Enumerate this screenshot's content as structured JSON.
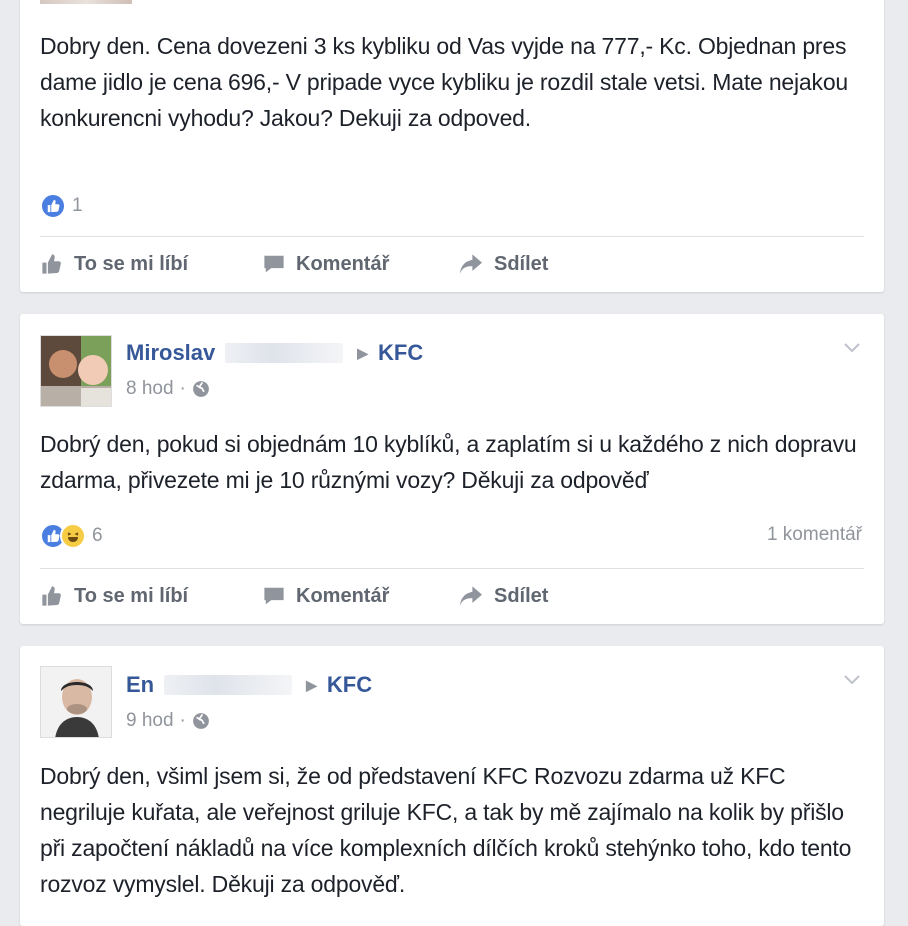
{
  "posts": [
    {
      "text": "Dobry den. Cena dovezeni 3 ks kybliku od Vas vyjde na 777,- Kc. Objednan pres dame jidlo je cena 696,- V pripade vyce kybliku je rozdil stale vetsi. Mate nejakou konkurencni vyhodu? Jakou? Dekuji za odpoved.",
      "reaction_count": "1"
    },
    {
      "author": "Miroslav",
      "page": "KFC",
      "time": "8 hod",
      "text": "Dobrý den, pokud si objednám 10 kyblíků, a zaplatím si u každého z nich dopravu zdarma, přivezete mi je 10 různými vozy? Děkuji za odpověď",
      "reaction_count": "6",
      "comments_count": "1 komentář"
    },
    {
      "author": "En",
      "page": "KFC",
      "time": "9 hod",
      "text": "Dobrý den, všiml jsem si, že od představení KFC Rozvozu zdarma už KFC negriluje kuřata, ale veřejnost griluje KFC, a tak by mě zajímalo na kolik by přišlo při započtení nákladů na více komplexních dílčích kroků stehýnko toho, kdo tento rozvoz vymyslel. Děkuji za odpověď."
    }
  ],
  "actions": {
    "like": "To se mi líbí",
    "comment": "Komentář",
    "share": "Sdílet"
  },
  "meta": {
    "separator": "·"
  },
  "icons": [
    "like-icon",
    "haha-icon",
    "thumb-icon",
    "comment-icon",
    "share-icon",
    "globe-icon",
    "chevron-down-icon",
    "arrow-right-icon"
  ],
  "colors": {
    "link": "#365899",
    "muted": "#90949c",
    "like_blue": "#4a7ee0",
    "background": "#e9ebee"
  }
}
